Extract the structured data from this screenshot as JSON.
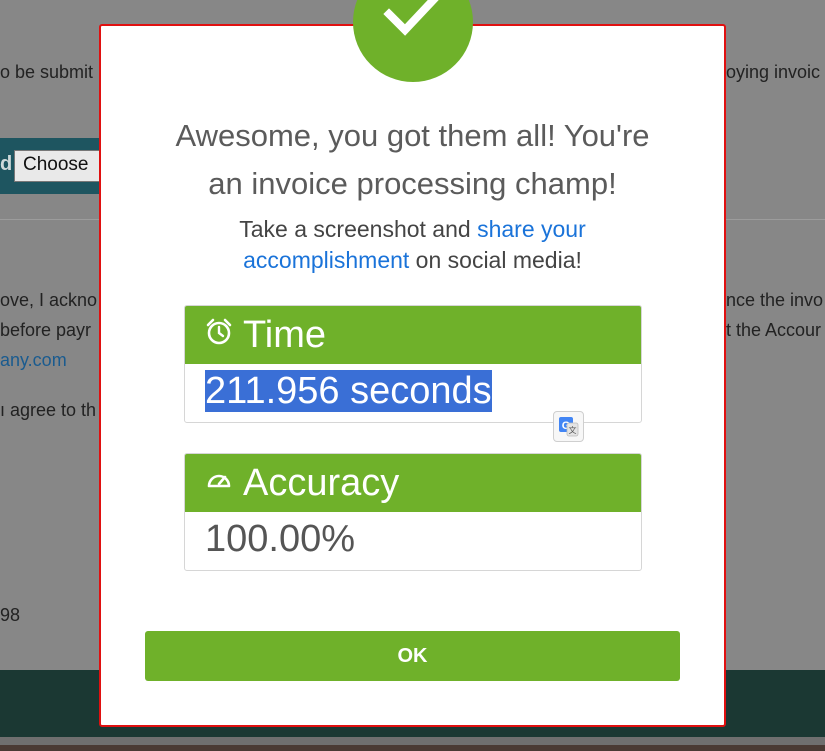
{
  "background": {
    "line1": "o be submit",
    "line1_right": "oying invoic",
    "file_label": "d",
    "file_button": "Choose",
    "line_ack_left": "ove, I ackno",
    "line_ack_right": "nce the invo",
    "line_pay_left": "before payr",
    "line_pay_right": "t the Accour",
    "link_text": "any.com",
    "line_agree": "ı agree to th",
    "line_number": "98"
  },
  "modal": {
    "title": "Awesome, you got them all! You're an invoice processing champ!",
    "subtitle_before": "Take a screenshot and ",
    "subtitle_link": "share your accomplishment",
    "subtitle_after": " on social media!",
    "time": {
      "label": "Time",
      "value": "211.956 seconds",
      "icon": "alarm-clock-icon"
    },
    "accuracy": {
      "label": "Accuracy",
      "value": "100.00%",
      "icon": "speedometer-icon"
    },
    "ok_label": "OK"
  },
  "colors": {
    "accent": "#6fb12a",
    "link": "#1a73d9",
    "modal_border": "#e01010",
    "selection": "#3a6fd6"
  }
}
